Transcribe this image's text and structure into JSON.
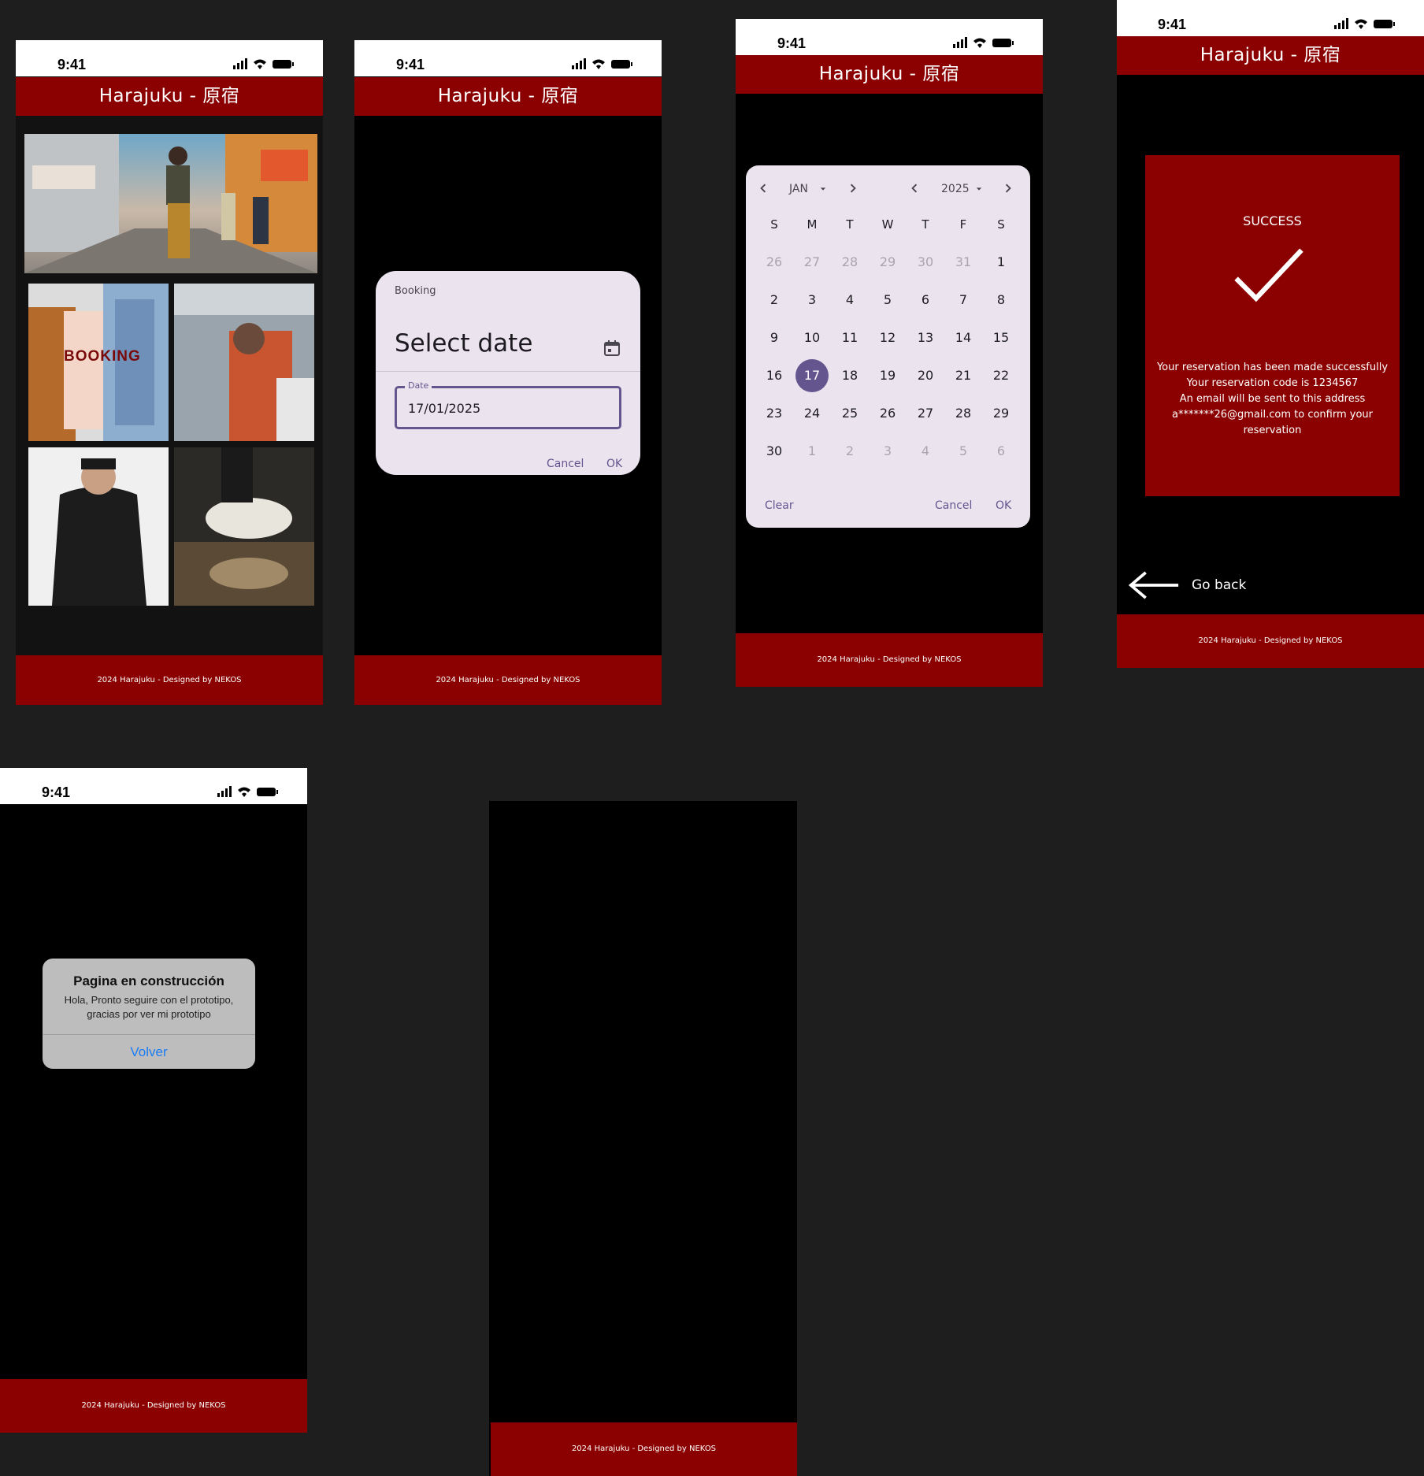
{
  "status": {
    "time": "9:41"
  },
  "app": {
    "title": "Harajuku  - 原宿",
    "footer": "2024 Harajuku - Designed by NEKOS"
  },
  "home": {
    "booking_label": "BOOKING"
  },
  "date_input": {
    "supporting": "Booking",
    "headline": "Select date",
    "field_label": "Date",
    "field_value": "17/01/2025",
    "cancel": "Cancel",
    "ok": "OK"
  },
  "calendar": {
    "month": "JAN",
    "year": "2025",
    "weekdays": [
      "S",
      "M",
      "T",
      "W",
      "T",
      "F",
      "S"
    ],
    "days": [
      [
        "26",
        "27",
        "28",
        "29",
        "30",
        "31",
        "1"
      ],
      [
        "2",
        "3",
        "4",
        "5",
        "6",
        "7",
        "8"
      ],
      [
        "9",
        "10",
        "11",
        "12",
        "13",
        "14",
        "15"
      ],
      [
        "16",
        "17",
        "18",
        "19",
        "20",
        "21",
        "22"
      ],
      [
        "23",
        "24",
        "25",
        "26",
        "27",
        "28",
        "29"
      ],
      [
        "30",
        "1",
        "2",
        "3",
        "4",
        "5",
        "6"
      ]
    ],
    "selected": "17",
    "clear": "Clear",
    "cancel": "Cancel",
    "ok": "OK",
    "accent": "#65558f"
  },
  "success": {
    "title": "SUCCESS",
    "message": [
      "Your reservation has been made successfully",
      "Your reservation code is 1234567",
      "An email will be sent to this address",
      "a*******26@gmail.com to confirm your",
      "reservation"
    ],
    "go_back": "Go back"
  },
  "alert": {
    "title": "Pagina en construcción",
    "body": [
      "Hola, Pronto seguire con el prototipo,",
      "gracias por ver mi prototipo"
    ],
    "action": "Volver"
  },
  "colors": {
    "brand": "#8b0000",
    "background": "#1e1e1e",
    "ios_blue": "#1a7cf5"
  }
}
